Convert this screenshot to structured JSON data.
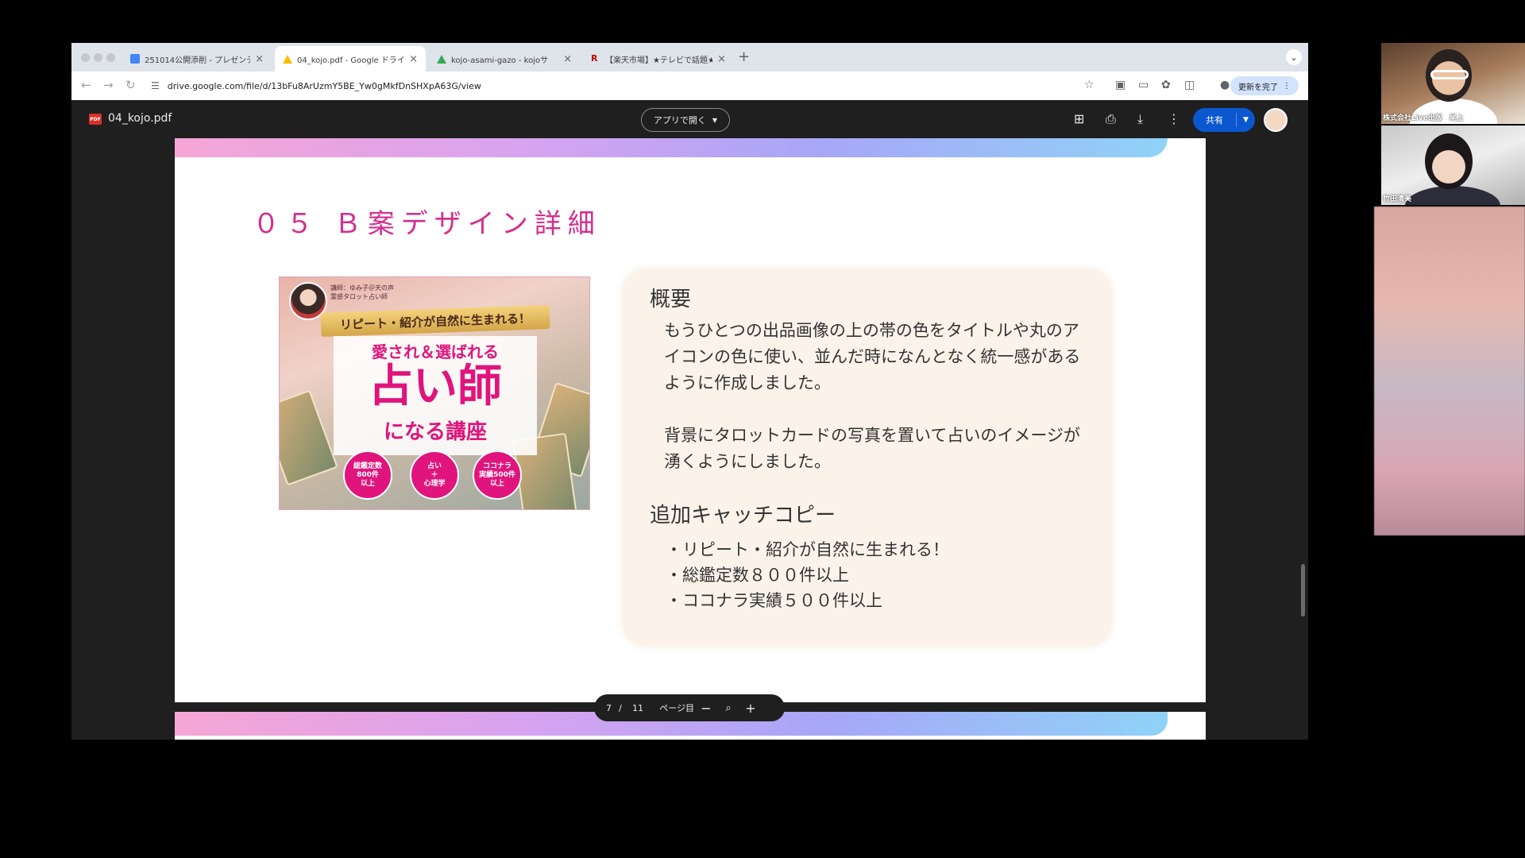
{
  "browser": {
    "tabs": [
      {
        "title": "251014公開添削 - プレゼンテー",
        "favicon": "slides-icon",
        "active": false
      },
      {
        "title": "04_kojo.pdf - Google ドライ",
        "favicon": "drive-icon",
        "active": true
      },
      {
        "title": "kojo-asami-gazo - kojoサ",
        "favicon": "drive-icon",
        "active": false
      },
      {
        "title": "【楽天市場】★テレビで話題★",
        "favicon": "rakuten-icon",
        "active": false
      }
    ],
    "url": "drive.google.com/file/d/13bFu8ArUzmY5BE_Yw0gMkfDnSHXpA63G/view",
    "update_label": "更新を完了"
  },
  "viewer": {
    "file_badge": "PDF",
    "file_name": "04_kojo.pdf",
    "open_with_label": "アプリで開く",
    "share_label": "共有"
  },
  "slide": {
    "title": "０５ Ｂ案デザイン詳細",
    "image": {
      "lecturer": "講師：ゆみ子＠天の声\n霊感タロット占い師",
      "ribbon": "リピート・紹介が自然に生まれる！",
      "tagline": "愛され＆選ばれる",
      "main": "占い師",
      "sub": "になる講座",
      "badges": [
        "総鑑定数\n800件\n以上",
        "占い\n＋\n心理学",
        "ココナラ\n実績500件\n以上"
      ]
    },
    "info": {
      "overview_heading": "概要",
      "overview_p1": "もうひとつの出品画像の上の帯の色をタイトルや丸のアイコンの色に使い、並んだ時になんとなく統一感があるように作成しました。",
      "overview_p2": "背景にタロットカードの写真を置いて占いのイメージが湧くようにしました。",
      "catch_heading": "追加キャッチコピー",
      "catch_items": [
        "・リピート・紹介が自然に生まれる！",
        "・総鑑定数８００件以上",
        "・ココナラ実績５００件以上"
      ]
    }
  },
  "page_control": {
    "current": "7",
    "separator": "/",
    "total": "11",
    "suffix": "ページ目"
  },
  "participants": [
    {
      "name": "株式会社Live出版　尾上"
    },
    {
      "name": "竹田清美"
    }
  ],
  "colors": {
    "accent_pink": "#d62c8c",
    "share_blue": "#0b57d0",
    "info_bg": "#fbf3ea"
  }
}
